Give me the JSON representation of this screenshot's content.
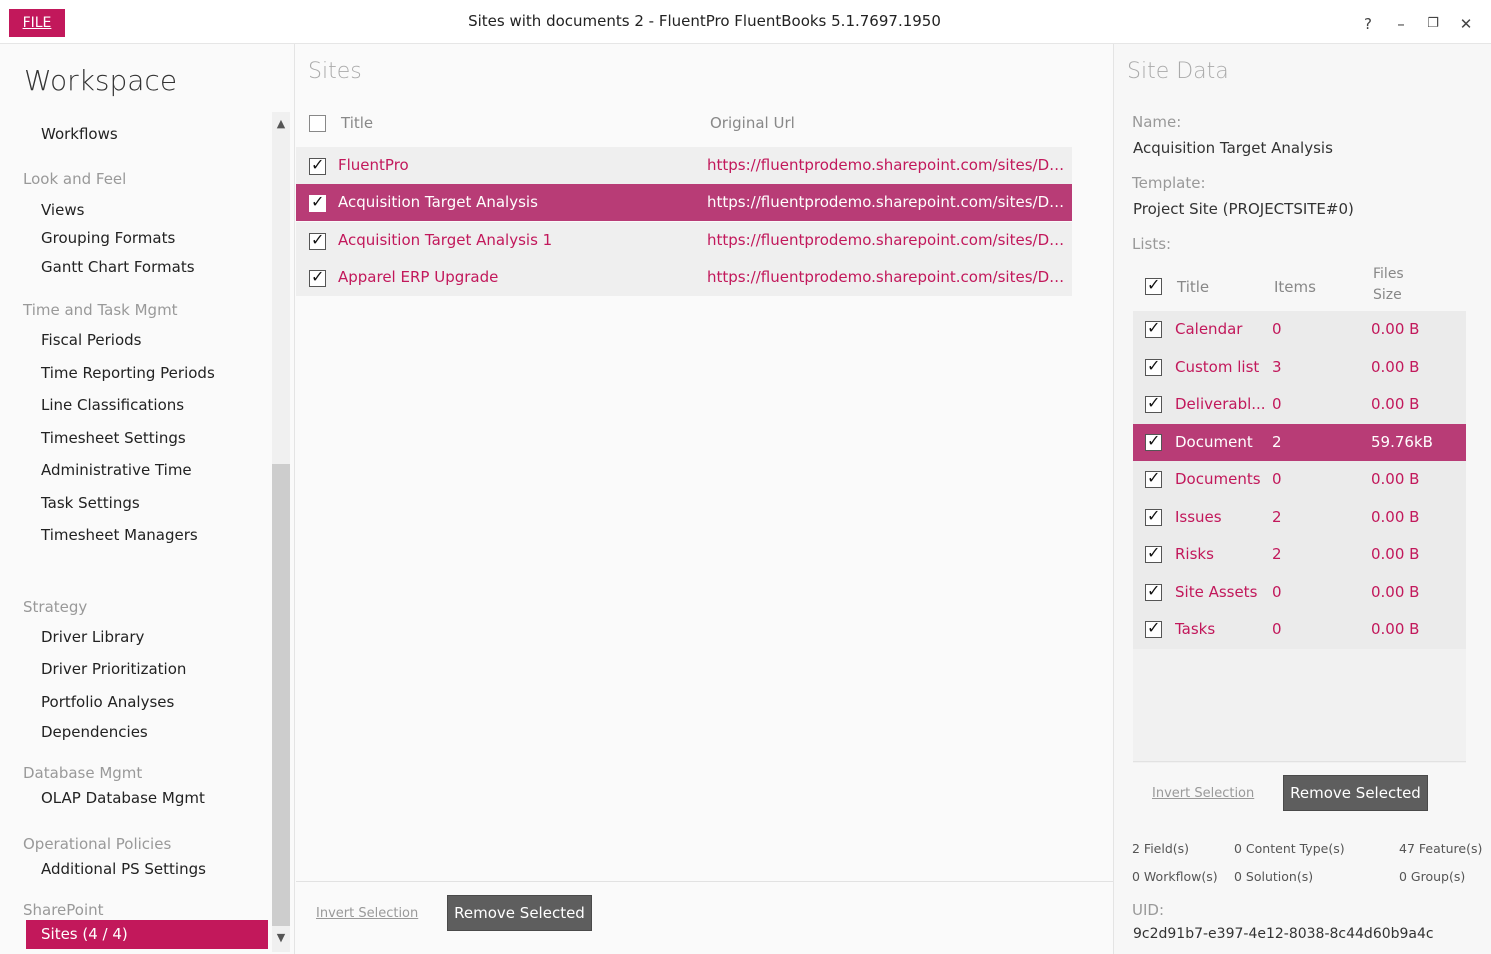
{
  "window": {
    "file_label": "FILE",
    "title": "Sites with documents 2 - FluentPro FluentBooks 5.1.7697.1950",
    "help": "?",
    "minimize": "–",
    "restore": "❐",
    "close": "✕"
  },
  "nav": {
    "title": "Workspace",
    "workflows": "Workflows",
    "look_and_feel": "Look and Feel",
    "views": "Views",
    "grouping_formats": "Grouping Formats",
    "gantt_chart_formats": "Gantt Chart Formats",
    "time_task": "Time and Task Mgmt",
    "fiscal_periods": "Fiscal Periods",
    "time_reporting_periods": "Time Reporting Periods",
    "line_classifications": "Line Classifications",
    "timesheet_settings": "Timesheet Settings",
    "administrative_time": "Administrative Time",
    "task_settings": "Task Settings",
    "timesheet_managers": "Timesheet Managers",
    "strategy": "Strategy",
    "driver_library": "Driver Library",
    "driver_prioritization": "Driver Prioritization",
    "portfolio_analyses": "Portfolio Analyses",
    "dependencies": "Dependencies",
    "database_mgmt": "Database Mgmt",
    "olap": "OLAP Database Mgmt",
    "operational_policies": "Operational Policies",
    "additional_ps": "Additional PS Settings",
    "sharepoint": "SharePoint",
    "sites": "Sites (4 / 4)"
  },
  "sites": {
    "heading": "Sites",
    "col_title": "Title",
    "col_url": "Original Url",
    "rows": [
      {
        "title": "FluentPro",
        "url": "https://fluentprodemo.sharepoint.com/sites/De..."
      },
      {
        "title": "Acquisition Target Analysis",
        "url": "https://fluentprodemo.sharepoint.com/sites/De..."
      },
      {
        "title": "Acquisition Target Analysis 1",
        "url": "https://fluentprodemo.sharepoint.com/sites/De..."
      },
      {
        "title": "Apparel ERP Upgrade",
        "url": "https://fluentprodemo.sharepoint.com/sites/De..."
      }
    ],
    "invert_selection": "Invert Selection",
    "remove_selected": "Remove Selected"
  },
  "site_data": {
    "heading": "Site Data",
    "name_label": "Name:",
    "name_value": "Acquisition Target Analysis",
    "template_label": "Template:",
    "template_value": "Project Site (PROJECTSITE#0)",
    "lists_label": "Lists:",
    "col_title": "Title",
    "col_items": "Items",
    "col_files_size_1": "Files",
    "col_files_size_2": "Size",
    "lists": [
      {
        "name": "Calendar",
        "items": "0",
        "size": "0.00 B"
      },
      {
        "name": "Custom list",
        "items": "3",
        "size": "0.00 B"
      },
      {
        "name": "Deliverabl...",
        "items": "0",
        "size": "0.00 B"
      },
      {
        "name": "Document",
        "items": "2",
        "size": "59.76kB"
      },
      {
        "name": "Documents",
        "items": "0",
        "size": "0.00 B"
      },
      {
        "name": "Issues",
        "items": "2",
        "size": "0.00 B"
      },
      {
        "name": "Risks",
        "items": "2",
        "size": "0.00 B"
      },
      {
        "name": "Site Assets",
        "items": "0",
        "size": "0.00 B"
      },
      {
        "name": "Tasks",
        "items": "0",
        "size": "0.00 B"
      }
    ],
    "invert_selection": "Invert Selection",
    "remove_selected": "Remove Selected",
    "fields": "2 Field(s)",
    "content_types": "0 Content Type(s)",
    "features": "47 Feature(s)",
    "workflows": "0 Workflow(s)",
    "solutions": "0 Solution(s)",
    "groups": "0 Group(s)",
    "uid_label": "UID:",
    "uid_value": "9c2d91b7-e397-4e12-8038-8c44d60b9a4c"
  },
  "colors": {
    "accent": "#c2185b",
    "selected_row": "#b83c76",
    "button_dark": "#5e5e5e"
  }
}
